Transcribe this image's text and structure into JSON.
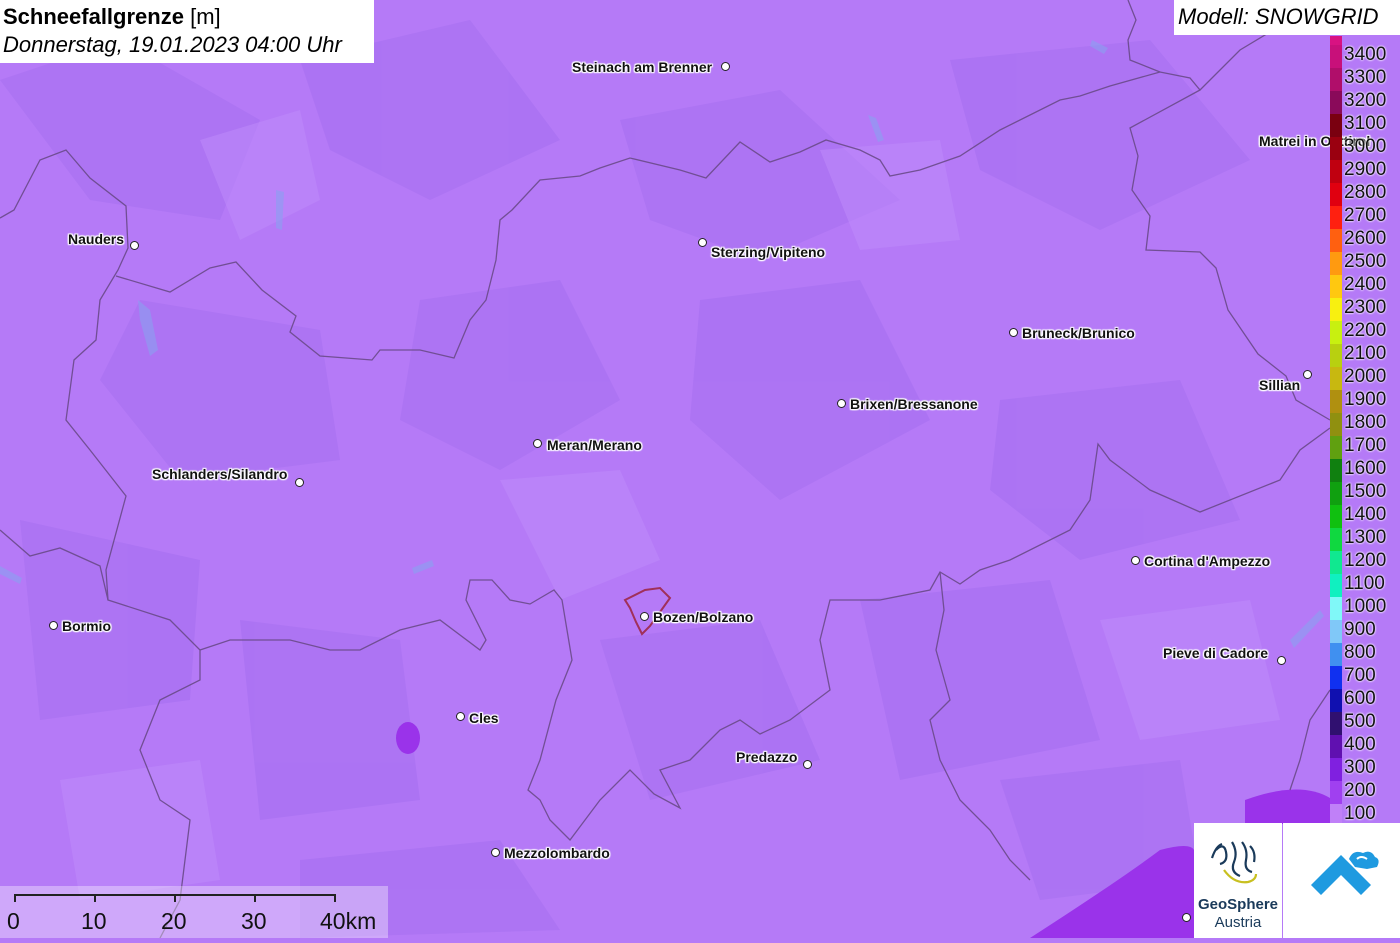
{
  "header": {
    "title_bold": "Schneefallgrenze",
    "title_unit": "[m]",
    "subtitle": "Donnerstag, 19.01.2023 04:00 Uhr",
    "model": "Modell: SNOWGRID"
  },
  "colors": {
    "map_base": "#b57af7",
    "map_shade": "#a366ee",
    "border_line": "#6a4a8a",
    "bolzano_outline": "#a0305a"
  },
  "cities": [
    {
      "name": "Steinach am Brenner"
    },
    {
      "name": "Nauders"
    },
    {
      "name": "Sterzing/Vipiteno"
    },
    {
      "name": "Bruneck/Brunico"
    },
    {
      "name": "Matrei in Osttirol"
    },
    {
      "name": "Sillian"
    },
    {
      "name": "Brixen/Bressanone"
    },
    {
      "name": "Meran/Merano"
    },
    {
      "name": "Schlanders/Silandro"
    },
    {
      "name": "Cortina d'Ampezzo"
    },
    {
      "name": "Bormio"
    },
    {
      "name": "Bozen/Bolzano"
    },
    {
      "name": "Pieve di Cadore"
    },
    {
      "name": "Cles"
    },
    {
      "name": "Predazzo"
    },
    {
      "name": "Mezzolombardo"
    }
  ],
  "legend": {
    "unit": "m",
    "levels": [
      {
        "value": "3400",
        "color": "#c8107a"
      },
      {
        "value": "3300",
        "color": "#b00e6a"
      },
      {
        "value": "3200",
        "color": "#8a0a5a"
      },
      {
        "value": "3100",
        "color": "#7a0010"
      },
      {
        "value": "3000",
        "color": "#9a0010"
      },
      {
        "value": "2900",
        "color": "#c00010"
      },
      {
        "value": "2800",
        "color": "#e00010"
      },
      {
        "value": "2700",
        "color": "#ff2010"
      },
      {
        "value": "2600",
        "color": "#ff6010"
      },
      {
        "value": "2500",
        "color": "#ff9a10"
      },
      {
        "value": "2400",
        "color": "#ffc810"
      },
      {
        "value": "2300",
        "color": "#f8f010"
      },
      {
        "value": "2200",
        "color": "#c8f010"
      },
      {
        "value": "2100",
        "color": "#b8d010"
      },
      {
        "value": "2000",
        "color": "#c8b810"
      },
      {
        "value": "1900",
        "color": "#b09010"
      },
      {
        "value": "1800",
        "color": "#909010"
      },
      {
        "value": "1700",
        "color": "#60a010"
      },
      {
        "value": "1600",
        "color": "#108010"
      },
      {
        "value": "1500",
        "color": "#10a010"
      },
      {
        "value": "1400",
        "color": "#10c010"
      },
      {
        "value": "1300",
        "color": "#10d840"
      },
      {
        "value": "1200",
        "color": "#10e890"
      },
      {
        "value": "1100",
        "color": "#10f0c0"
      },
      {
        "value": "1000",
        "color": "#80f8f8"
      },
      {
        "value": "900",
        "color": "#80c8f8"
      },
      {
        "value": "800",
        "color": "#4090f0"
      },
      {
        "value": "700",
        "color": "#1030f0"
      },
      {
        "value": "600",
        "color": "#1010b0"
      },
      {
        "value": "500",
        "color": "#301070"
      },
      {
        "value": "400",
        "color": "#6010b0"
      },
      {
        "value": "300",
        "color": "#8020e0"
      },
      {
        "value": "200",
        "color": "#a040f0"
      },
      {
        "value": "100",
        "color": "#c080f8"
      }
    ]
  },
  "scale": {
    "labels": [
      "0",
      "10",
      "20",
      "30",
      "40km"
    ]
  },
  "logos": {
    "geosphere": "GeoSphere",
    "austria": "Austria"
  }
}
